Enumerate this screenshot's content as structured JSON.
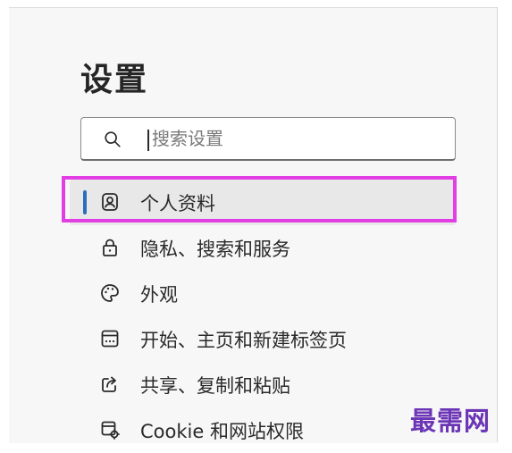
{
  "settings": {
    "title": "设置",
    "search": {
      "placeholder": "搜索设置",
      "icon": "search-icon"
    },
    "nav": {
      "items": [
        {
          "label": "个人资料",
          "icon": "profile-icon",
          "active": true
        },
        {
          "label": "隐私、搜索和服务",
          "icon": "lock-icon",
          "active": false
        },
        {
          "label": "外观",
          "icon": "palette-icon",
          "active": false
        },
        {
          "label": "开始、主页和新建标签页",
          "icon": "home-page-icon",
          "active": false
        },
        {
          "label": "共享、复制和粘贴",
          "icon": "share-icon",
          "active": false
        },
        {
          "label": "Cookie 和网站权限",
          "icon": "site-permissions-icon",
          "active": false
        }
      ]
    }
  },
  "colors": {
    "active_indicator": "#2a6ebd",
    "highlight_border": "#e13fe4",
    "watermark": "#6b35b6"
  },
  "watermark": {
    "text": "最需网"
  }
}
